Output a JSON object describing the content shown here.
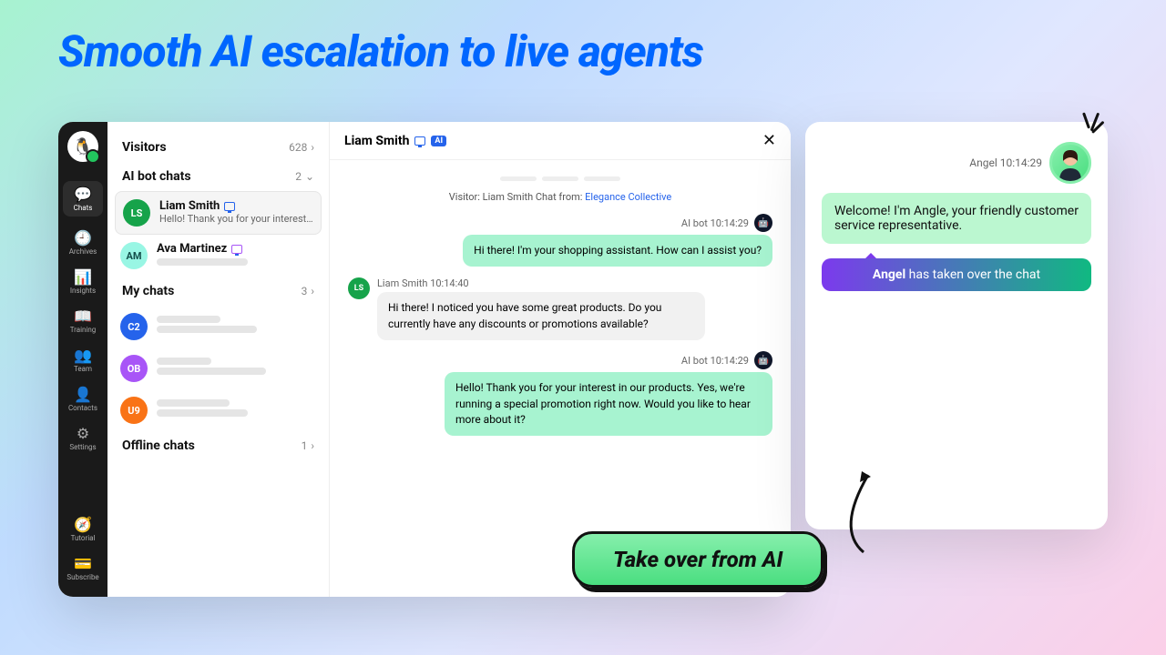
{
  "hero": {
    "title": "Smooth AI escalation to live agents"
  },
  "rail": {
    "items": [
      {
        "label": "Chats",
        "key": "chats"
      },
      {
        "label": "Archives",
        "key": "archives"
      },
      {
        "label": "Insights",
        "key": "insights"
      },
      {
        "label": "Training",
        "key": "training"
      },
      {
        "label": "Team",
        "key": "team"
      },
      {
        "label": "Contacts",
        "key": "contacts"
      },
      {
        "label": "Settings",
        "key": "settings"
      }
    ],
    "footer": [
      {
        "label": "Tutorial",
        "key": "tutorial"
      },
      {
        "label": "Subscribe",
        "key": "subscribe"
      }
    ]
  },
  "chatlist": {
    "visitors": {
      "label": "Visitors",
      "count": "628"
    },
    "ai_section": {
      "label": "AI bot chats",
      "count": "2"
    },
    "ai_chats": [
      {
        "initials": "LS",
        "name": "Liam Smith",
        "preview": "Hello! Thank you for your interest..."
      },
      {
        "initials": "AM",
        "name": "Ava Martinez",
        "preview": ""
      }
    ],
    "my_section": {
      "label": "My chats",
      "count": "3"
    },
    "my_chats": [
      {
        "initials": "C2"
      },
      {
        "initials": "OB"
      },
      {
        "initials": "U9"
      }
    ],
    "offline_section": {
      "label": "Offline chats",
      "count": "1"
    }
  },
  "conversation": {
    "title": "Liam Smith",
    "ai_badge": "AI",
    "context_prefix": "Visitor: Liam Smith Chat from: ",
    "context_link": "Elegance Collective",
    "messages": [
      {
        "side": "bot",
        "meta": "AI bot 10:14:29",
        "text": "Hi there! I'm your shopping assistant. How can I assist you?"
      },
      {
        "side": "visitor",
        "meta": "Liam Smith 10:14:40",
        "initials": "LS",
        "text": "Hi there! I noticed you have some great products. Do you currently have any discounts or promotions available?"
      },
      {
        "side": "bot",
        "meta": "AI bot 10:14:29",
        "text": "Hello! Thank you for your interest in our products. Yes, we're running a special promotion right now. Would you like to hear more about it?"
      }
    ]
  },
  "angel": {
    "meta": "Angel 10:14:29",
    "bubble": "Welcome! I'm Angle, your friendly customer service representative.",
    "banner_name": "Angel",
    "banner_rest": " has taken over the chat"
  },
  "callout": {
    "label": "Take over from AI"
  }
}
